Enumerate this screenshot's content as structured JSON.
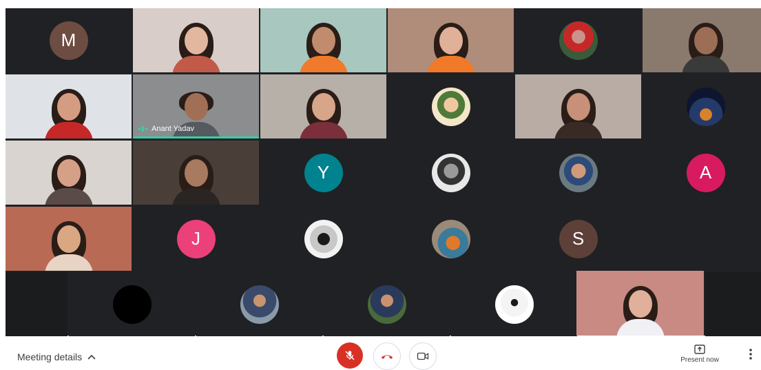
{
  "tiles": {
    "r1c1_initial": "M",
    "r2c2_name": "Anant Yadav",
    "r3c3_initial": "Y",
    "r3c6_initial": "A",
    "r4c2_initial": "J",
    "r4c5_initial": "S"
  },
  "colors": {
    "grid_bg": "#202124",
    "active_speaker": "#34d1a8",
    "mic_off": "#d93025",
    "avatar_M": "#6d4c41",
    "avatar_Y": "#00838f",
    "avatar_A": "#d81b60",
    "avatar_J": "#ec407a",
    "avatar_S": "#5d4037"
  },
  "bottom_bar": {
    "meeting_details_label": "Meeting details",
    "present_now_label": "Present now"
  },
  "icons": {
    "mic": "mic-off-icon",
    "leave": "call-end-icon",
    "camera": "videocam-icon",
    "present": "present-icon",
    "more": "more-vert-icon",
    "chevron": "chevron-up-icon"
  }
}
